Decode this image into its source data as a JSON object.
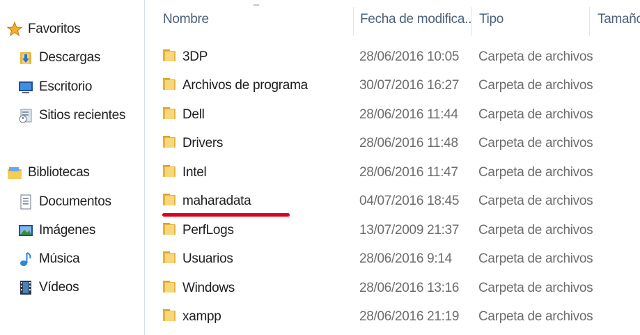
{
  "nav": {
    "favorites": {
      "label": "Favoritos",
      "items": [
        {
          "label": "Descargas",
          "icon": "downloads-folder-icon"
        },
        {
          "label": "Escritorio",
          "icon": "desktop-icon"
        },
        {
          "label": "Sitios recientes",
          "icon": "recent-places-icon"
        }
      ]
    },
    "libraries": {
      "label": "Bibliotecas",
      "items": [
        {
          "label": "Documentos",
          "icon": "documents-icon"
        },
        {
          "label": "Imágenes",
          "icon": "pictures-icon"
        },
        {
          "label": "Música",
          "icon": "music-icon"
        },
        {
          "label": "Vídeos",
          "icon": "videos-icon"
        }
      ]
    }
  },
  "columns": {
    "name": "Nombre",
    "date": "Fecha de modifica...",
    "type": "Tipo",
    "size": "Tamaño"
  },
  "files": [
    {
      "name": "3DP",
      "date": "28/06/2016 10:05",
      "type": "Carpeta de archivos"
    },
    {
      "name": "Archivos de programa",
      "date": "30/07/2016 16:27",
      "type": "Carpeta de archivos"
    },
    {
      "name": "Dell",
      "date": "28/06/2016 11:44",
      "type": "Carpeta de archivos"
    },
    {
      "name": "Drivers",
      "date": "28/06/2016 11:48",
      "type": "Carpeta de archivos"
    },
    {
      "name": "Intel",
      "date": "28/06/2016 11:47",
      "type": "Carpeta de archivos"
    },
    {
      "name": "maharadata",
      "date": "04/07/2016 18:45",
      "type": "Carpeta de archivos",
      "highlighted": true
    },
    {
      "name": "PerfLogs",
      "date": "13/07/2009 21:37",
      "type": "Carpeta de archivos"
    },
    {
      "name": "Usuarios",
      "date": "28/06/2016 9:14",
      "type": "Carpeta de archivos"
    },
    {
      "name": "Windows",
      "date": "28/06/2016 13:16",
      "type": "Carpeta de archivos"
    },
    {
      "name": "xampp",
      "date": "28/06/2016 21:19",
      "type": "Carpeta de archivos"
    }
  ],
  "colors": {
    "highlight_underline": "#e0001a",
    "header_text": "#4c607a",
    "folder_yellow": "#f2c94c"
  }
}
